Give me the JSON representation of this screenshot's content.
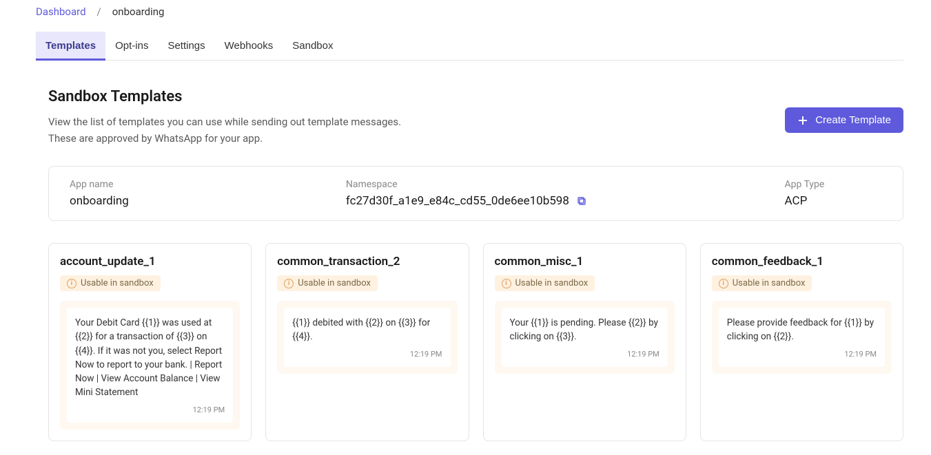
{
  "breadcrumb": {
    "root": "Dashboard",
    "separator": "/",
    "current": "onboarding"
  },
  "tabs": [
    {
      "label": "Templates",
      "active": true
    },
    {
      "label": "Opt-ins",
      "active": false
    },
    {
      "label": "Settings",
      "active": false
    },
    {
      "label": "Webhooks",
      "active": false
    },
    {
      "label": "Sandbox",
      "active": false
    }
  ],
  "header": {
    "title": "Sandbox Templates",
    "subtitle_line1": "View the list of templates you can use while sending out template messages.",
    "subtitle_line2": "These are approved by WhatsApp for your app.",
    "create_button": "Create Template"
  },
  "app_info": {
    "app_name_label": "App name",
    "app_name_value": "onboarding",
    "namespace_label": "Namespace",
    "namespace_value": "fc27d30f_a1e9_e84c_cd55_0de6ee10b598",
    "app_type_label": "App Type",
    "app_type_value": "ACP"
  },
  "badge_text": "Usable in sandbox",
  "templates": [
    {
      "name": "account_update_1",
      "message": "Your Debit Card {{1}} was used at {{2}} for a transaction of {{3}} on {{4}}. If it was not you, select Report Now to report to your bank. | Report Now | View Account Balance | View Mini Statement",
      "time": "12:19 PM"
    },
    {
      "name": "common_transaction_2",
      "message": "{{1}} debited with {{2}} on {{3}} for {{4}}.",
      "time": "12:19 PM"
    },
    {
      "name": "common_misc_1",
      "message": "Your {{1}} is pending. Please {{2}} by clicking on {{3}}.",
      "time": "12:19 PM"
    },
    {
      "name": "common_feedback_1",
      "message": "Please provide feedback for {{1}} by clicking on {{2}}.",
      "time": "12:19 PM"
    }
  ]
}
